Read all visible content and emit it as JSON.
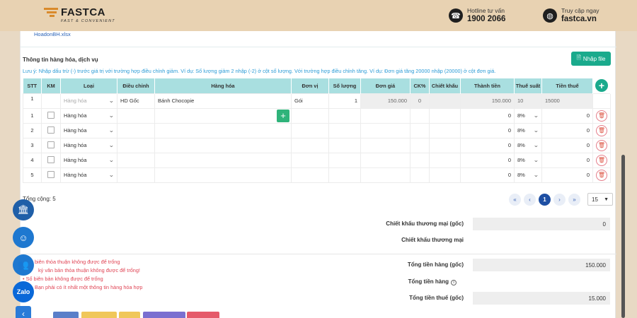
{
  "header": {
    "brand": "FASTCA",
    "tagline": "FAST & CONVENIENT",
    "hotline_label": "Hotline tư vấn",
    "hotline_number": "1900 2066",
    "site_label": "Truy cập ngay",
    "site_url": "fastca.vn"
  },
  "file_name": "HoadonBH.xlsx",
  "section_title": "Thông tin hàng hóa, dịch vụ",
  "import_button": "Nhập file",
  "note": "Lưu ý: Nhập dấu trừ (-) trước giá trị với trường hợp điều chỉnh giảm. Ví dụ: Số lượng giảm 2 nhập (-2) ở cột số lượng. Với trường hợp điều chỉnh tăng. Ví dụ: Đơn giá tăng 20000 nhập (20000) ở cột đơn giá.",
  "table": {
    "headers": [
      "STT",
      "KM",
      "Loại",
      "Điều chỉnh",
      "Hàng hóa",
      "Đơn vị",
      "Số lượng",
      "Đơn giá",
      "CK%",
      "Chiết khấu",
      "Thành tiền",
      "Thuế suất",
      "Tiền thuế"
    ],
    "original_row": {
      "stt": "1",
      "type": "Hàng hóa",
      "adjust": "HD Gốc",
      "item": "Bánh Chocopie",
      "unit": "Gói",
      "qty": "1",
      "price": "150.000",
      "ck": "0",
      "amount": "150.000",
      "tax_rate": "10",
      "tax": "15000"
    },
    "rows": [
      {
        "stt": "1",
        "type": "Hàng hóa",
        "amount": "0",
        "tax_rate": "8%",
        "tax": "0"
      },
      {
        "stt": "2",
        "type": "Hàng hóa",
        "amount": "0",
        "tax_rate": "8%",
        "tax": "0"
      },
      {
        "stt": "3",
        "type": "Hàng hóa",
        "amount": "0",
        "tax_rate": "8%",
        "tax": "0"
      },
      {
        "stt": "4",
        "type": "Hàng hóa",
        "amount": "0",
        "tax_rate": "8%",
        "tax": "0"
      },
      {
        "stt": "5",
        "type": "Hàng hóa",
        "amount": "0",
        "tax_rate": "8%",
        "tax": "0"
      }
    ]
  },
  "total_count": "Tổng cộng: 5",
  "pagination": {
    "first": "«",
    "prev": "‹",
    "current": "1",
    "next": "›",
    "last": "»",
    "page_size": "15"
  },
  "summary": {
    "discount_orig_label": "Chiết khấu thương mại (gốc)",
    "discount_orig_value": "0",
    "discount_label": "Chiết khấu thương mại",
    "discount_value": "",
    "goods_total_orig_label": "Tổng tiền hàng (gốc)",
    "goods_total_orig_value": "150.000",
    "goods_total_label": "Tổng tiền hàng",
    "goods_total_value": "",
    "tax_total_orig_label": "Tổng tiền thuế (gốc)",
    "tax_total_orig_value": "15.000"
  },
  "errors": [
    "biên thỏa thuận không được để trống",
    "ký văn bản thỏa thuận không được để trống!",
    "Số biên bản không được để trống",
    "Bạn phải có ít nhất một thông tin hàng hóa hợp"
  ],
  "floating": {
    "zalo_label": "Zalo"
  },
  "colors": {
    "accent": "#1aaa8c",
    "header_bg": "#e8d2b2",
    "table_head": "#a9dfe0",
    "error": "#e04454",
    "link": "#2a63b8"
  }
}
